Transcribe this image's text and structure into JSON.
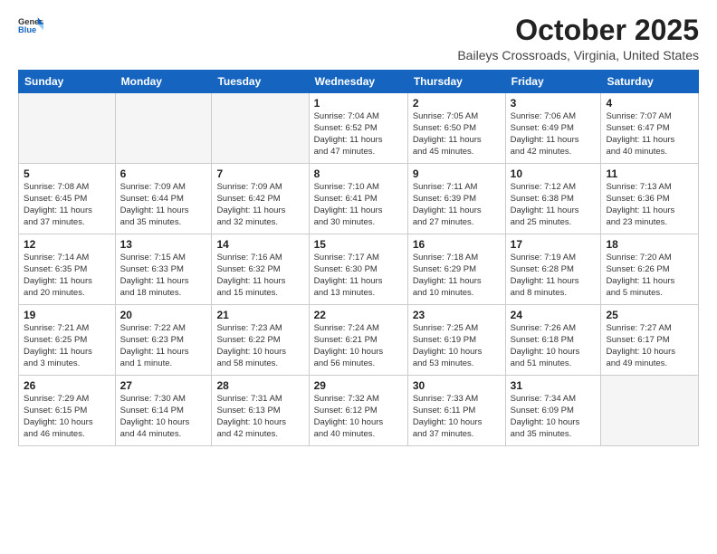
{
  "logo": {
    "general": "General",
    "blue": "Blue"
  },
  "header": {
    "month_title": "October 2025",
    "location": "Baileys Crossroads, Virginia, United States"
  },
  "weekdays": [
    "Sunday",
    "Monday",
    "Tuesday",
    "Wednesday",
    "Thursday",
    "Friday",
    "Saturday"
  ],
  "weeks": [
    [
      {
        "day": "",
        "info": ""
      },
      {
        "day": "",
        "info": ""
      },
      {
        "day": "",
        "info": ""
      },
      {
        "day": "1",
        "info": "Sunrise: 7:04 AM\nSunset: 6:52 PM\nDaylight: 11 hours\nand 47 minutes."
      },
      {
        "day": "2",
        "info": "Sunrise: 7:05 AM\nSunset: 6:50 PM\nDaylight: 11 hours\nand 45 minutes."
      },
      {
        "day": "3",
        "info": "Sunrise: 7:06 AM\nSunset: 6:49 PM\nDaylight: 11 hours\nand 42 minutes."
      },
      {
        "day": "4",
        "info": "Sunrise: 7:07 AM\nSunset: 6:47 PM\nDaylight: 11 hours\nand 40 minutes."
      }
    ],
    [
      {
        "day": "5",
        "info": "Sunrise: 7:08 AM\nSunset: 6:45 PM\nDaylight: 11 hours\nand 37 minutes."
      },
      {
        "day": "6",
        "info": "Sunrise: 7:09 AM\nSunset: 6:44 PM\nDaylight: 11 hours\nand 35 minutes."
      },
      {
        "day": "7",
        "info": "Sunrise: 7:09 AM\nSunset: 6:42 PM\nDaylight: 11 hours\nand 32 minutes."
      },
      {
        "day": "8",
        "info": "Sunrise: 7:10 AM\nSunset: 6:41 PM\nDaylight: 11 hours\nand 30 minutes."
      },
      {
        "day": "9",
        "info": "Sunrise: 7:11 AM\nSunset: 6:39 PM\nDaylight: 11 hours\nand 27 minutes."
      },
      {
        "day": "10",
        "info": "Sunrise: 7:12 AM\nSunset: 6:38 PM\nDaylight: 11 hours\nand 25 minutes."
      },
      {
        "day": "11",
        "info": "Sunrise: 7:13 AM\nSunset: 6:36 PM\nDaylight: 11 hours\nand 23 minutes."
      }
    ],
    [
      {
        "day": "12",
        "info": "Sunrise: 7:14 AM\nSunset: 6:35 PM\nDaylight: 11 hours\nand 20 minutes."
      },
      {
        "day": "13",
        "info": "Sunrise: 7:15 AM\nSunset: 6:33 PM\nDaylight: 11 hours\nand 18 minutes."
      },
      {
        "day": "14",
        "info": "Sunrise: 7:16 AM\nSunset: 6:32 PM\nDaylight: 11 hours\nand 15 minutes."
      },
      {
        "day": "15",
        "info": "Sunrise: 7:17 AM\nSunset: 6:30 PM\nDaylight: 11 hours\nand 13 minutes."
      },
      {
        "day": "16",
        "info": "Sunrise: 7:18 AM\nSunset: 6:29 PM\nDaylight: 11 hours\nand 10 minutes."
      },
      {
        "day": "17",
        "info": "Sunrise: 7:19 AM\nSunset: 6:28 PM\nDaylight: 11 hours\nand 8 minutes."
      },
      {
        "day": "18",
        "info": "Sunrise: 7:20 AM\nSunset: 6:26 PM\nDaylight: 11 hours\nand 5 minutes."
      }
    ],
    [
      {
        "day": "19",
        "info": "Sunrise: 7:21 AM\nSunset: 6:25 PM\nDaylight: 11 hours\nand 3 minutes."
      },
      {
        "day": "20",
        "info": "Sunrise: 7:22 AM\nSunset: 6:23 PM\nDaylight: 11 hours\nand 1 minute."
      },
      {
        "day": "21",
        "info": "Sunrise: 7:23 AM\nSunset: 6:22 PM\nDaylight: 10 hours\nand 58 minutes."
      },
      {
        "day": "22",
        "info": "Sunrise: 7:24 AM\nSunset: 6:21 PM\nDaylight: 10 hours\nand 56 minutes."
      },
      {
        "day": "23",
        "info": "Sunrise: 7:25 AM\nSunset: 6:19 PM\nDaylight: 10 hours\nand 53 minutes."
      },
      {
        "day": "24",
        "info": "Sunrise: 7:26 AM\nSunset: 6:18 PM\nDaylight: 10 hours\nand 51 minutes."
      },
      {
        "day": "25",
        "info": "Sunrise: 7:27 AM\nSunset: 6:17 PM\nDaylight: 10 hours\nand 49 minutes."
      }
    ],
    [
      {
        "day": "26",
        "info": "Sunrise: 7:29 AM\nSunset: 6:15 PM\nDaylight: 10 hours\nand 46 minutes."
      },
      {
        "day": "27",
        "info": "Sunrise: 7:30 AM\nSunset: 6:14 PM\nDaylight: 10 hours\nand 44 minutes."
      },
      {
        "day": "28",
        "info": "Sunrise: 7:31 AM\nSunset: 6:13 PM\nDaylight: 10 hours\nand 42 minutes."
      },
      {
        "day": "29",
        "info": "Sunrise: 7:32 AM\nSunset: 6:12 PM\nDaylight: 10 hours\nand 40 minutes."
      },
      {
        "day": "30",
        "info": "Sunrise: 7:33 AM\nSunset: 6:11 PM\nDaylight: 10 hours\nand 37 minutes."
      },
      {
        "day": "31",
        "info": "Sunrise: 7:34 AM\nSunset: 6:09 PM\nDaylight: 10 hours\nand 35 minutes."
      },
      {
        "day": "",
        "info": ""
      }
    ]
  ]
}
